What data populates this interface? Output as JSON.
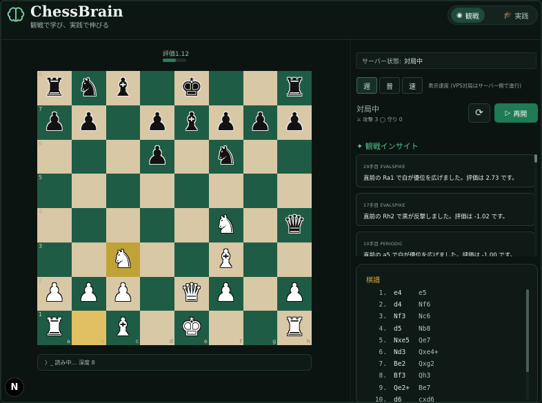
{
  "header": {
    "title": "ChessBrain",
    "subtitle": "観戦で学び、実践で伸びる",
    "modes": [
      {
        "label": "観戦",
        "icon": "eye-icon",
        "active": true
      },
      {
        "label": "実践",
        "icon": "graduation-cap-icon",
        "active": false
      }
    ]
  },
  "evaluation": {
    "label": "評価",
    "value": "1.12",
    "bar_fill_fraction": 0.55
  },
  "board": {
    "ranks": [
      "8",
      "7",
      "6",
      "5",
      "4",
      "3",
      "2",
      "1"
    ],
    "files": [
      "a",
      "b",
      "c",
      "d",
      "e",
      "f",
      "g",
      "h"
    ],
    "rows": [
      [
        "r",
        "n",
        "b",
        "",
        "k",
        "",
        "",
        "r"
      ],
      [
        "p",
        "p",
        "",
        "p",
        "b",
        "p",
        "p",
        "p"
      ],
      [
        "",
        "",
        "",
        "p",
        "",
        "n",
        "",
        ""
      ],
      [
        "",
        "",
        "",
        "",
        "",
        "",
        "",
        ""
      ],
      [
        "",
        "",
        "",
        "",
        "",
        "N",
        "",
        "q"
      ],
      [
        "",
        "",
        "N",
        "",
        "",
        "B",
        "",
        ""
      ],
      [
        "P",
        "P",
        "P",
        "",
        "Q",
        "P",
        "",
        "P"
      ],
      [
        "R",
        "",
        "B",
        "",
        "K",
        "",
        "",
        "R"
      ]
    ],
    "highlights": {
      "from": "b1",
      "to": "c3"
    }
  },
  "engine_status": {
    "text": "〉_ 読み中… 深度 8"
  },
  "server": {
    "label": "サーバー状態:",
    "value": "対局中"
  },
  "speed": {
    "buttons": [
      "遅",
      "普",
      "速"
    ],
    "active_index": 0,
    "note": "表示速度 (VPS対局はサーバー側で進行)"
  },
  "game": {
    "state": "対局中",
    "meta": "⚔ 攻撃 3 ◯ 守り 0",
    "replay_label": "再開"
  },
  "insights": {
    "title": "観戦インサイト",
    "cards": [
      {
        "meta": "29手目 EVALSPIKE",
        "text": "直前の Ra1 で白が優位を広げました。評価は 2.73 です。"
      },
      {
        "meta": "17手目 EVALSPIKE",
        "text": "直前の Rh2 で黒が反撃しました。評価は -1.02 です。"
      },
      {
        "meta": "10手目 PERIODIC",
        "text": "直前の a5 で白が優位を広げました。評価は -1.00 です。"
      }
    ]
  },
  "moves": {
    "title": "棋譜",
    "list": [
      {
        "num": "1.",
        "white": "e4",
        "black": "e5"
      },
      {
        "num": "2.",
        "white": "d4",
        "black": "Nf6"
      },
      {
        "num": "3.",
        "white": "Nf3",
        "black": "Nc6"
      },
      {
        "num": "4.",
        "white": "d5",
        "black": "Nb8"
      },
      {
        "num": "5.",
        "white": "Nxe5",
        "black": "Qe7"
      },
      {
        "num": "6.",
        "white": "Nd3",
        "black": "Qxe4+"
      },
      {
        "num": "7.",
        "white": "Be2",
        "black": "Qxg2"
      },
      {
        "num": "8.",
        "white": "Bf3",
        "black": "Qh3"
      },
      {
        "num": "9.",
        "white": "Qe2+",
        "black": "Be7"
      },
      {
        "num": "10.",
        "white": "d6",
        "black": "cxd6"
      }
    ]
  },
  "badge": {
    "letter": "N"
  }
}
